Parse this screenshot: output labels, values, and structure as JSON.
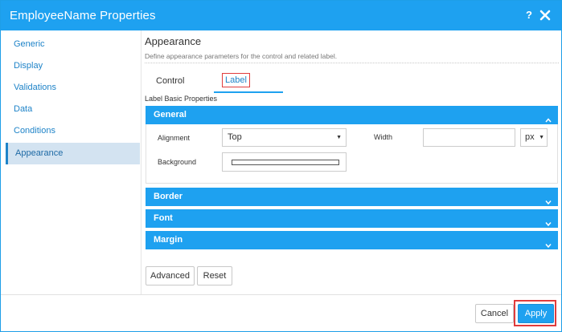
{
  "window": {
    "title": "EmployeeName Properties",
    "help_label": "?",
    "close_icon": "close-icon"
  },
  "sidebar": {
    "items": [
      {
        "label": "Generic"
      },
      {
        "label": "Display"
      },
      {
        "label": "Validations"
      },
      {
        "label": "Data"
      },
      {
        "label": "Conditions"
      },
      {
        "label": "Appearance",
        "active": true
      }
    ]
  },
  "main": {
    "title": "Appearance",
    "description": "Define appearance parameters for the control and related label.",
    "tabs": [
      {
        "label": "Control"
      },
      {
        "label": "Label",
        "active": true
      }
    ],
    "subheading": "Label Basic Properties",
    "sections": {
      "general": {
        "title": "General",
        "alignment_label": "Alignment",
        "alignment_value": "Top",
        "width_label": "Width",
        "width_value": "",
        "width_unit": "px",
        "background_label": "Background"
      },
      "border": {
        "title": "Border"
      },
      "font": {
        "title": "Font"
      },
      "margin": {
        "title": "Margin"
      }
    },
    "buttons": {
      "advanced": "Advanced",
      "reset": "Reset"
    }
  },
  "footer": {
    "cancel": "Cancel",
    "apply": "Apply"
  },
  "colors": {
    "accent": "#1ea1f0",
    "highlight": "#e03c3c",
    "link": "#1e83c8"
  }
}
